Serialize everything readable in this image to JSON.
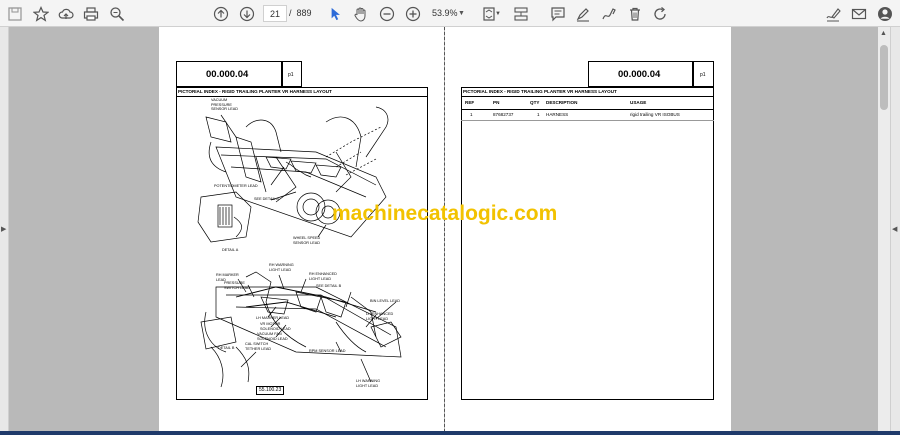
{
  "toolbar": {
    "current_page": "21",
    "page_separator": "/",
    "total_pages": "889",
    "zoom": "53.9%",
    "icons": [
      "save-icon",
      "star-icon",
      "upload-cloud-icon",
      "print-icon",
      "zoom-search-icon",
      "page-up-icon",
      "page-down-icon",
      "select-cursor-icon",
      "hand-pan-icon",
      "zoom-out-icon",
      "zoom-in-icon",
      "fit-page-icon",
      "scroll-mode-icon",
      "comment-icon",
      "highlight-pen-icon",
      "draw-icon",
      "delete-icon",
      "rotate-icon",
      "edit-sign-icon",
      "email-icon",
      "account-icon"
    ]
  },
  "left_page": {
    "code": "00.000.04",
    "page_marker": "p1",
    "title": "PICTORIAL INDEX - RIGID TRAILING PLANTER VR HARNESS LAYOUT",
    "diagram_labels": {
      "vacuum_pressure": "VACUUM\nPRESSURE\nSENSOR LEAD",
      "potentiometer": "POTENTIOMETER LEAD",
      "see_detail_a": "SEE DETAIL  A",
      "wheel_speed": "WHEEL SPEED\nSENSOR LEAD",
      "detail_a": "DETAIL  A",
      "rh_warning": "RH WARNING\nLIGHT LEAD",
      "rh_marker": "RH MARKER\nLEAD",
      "pressure_switch": "PRESSURE\nSWITCH LEAD",
      "rh_enhanced": "RH ENHANCED\nLIGHT LEAD",
      "see_detail_b": "SEE DETAIL B",
      "bin_level": "BIN LEVEL LEAD",
      "lh_enhanced": "LH ENHANCED\nLIGHT LEAD",
      "lh_marker": "LH MARKER LEAD",
      "vr_motor": "VR MOTOR\nSOLENOID LEAD",
      "vacuum_fan": "VACUUM FAN\nSOLENOID LEAD",
      "cal_switch": "CAL SWITCH\nTETHER LEAD",
      "detail_b": "DETAIL  B",
      "rpm_sensor": "RPM SENSOR LEAD",
      "lh_warning": "LH WARNING\nLIGHT LEAD"
    },
    "figure_ref": "55.100.23"
  },
  "right_page": {
    "code": "00.000.04",
    "page_marker": "p1",
    "title": "PICTORIAL INDEX - RIGID TRAILING PLANTER VR HARNESS LAYOUT",
    "columns": [
      "REF",
      "PN",
      "QTY",
      "DESCRIPTION",
      "USAGE"
    ],
    "rows": [
      {
        "ref": "1",
        "pn": "87682737",
        "qty": "1",
        "description": "HARNESS",
        "usage": "rigid trailing VR ISOBUS"
      }
    ]
  },
  "watermark": "machinecatalogic.com"
}
